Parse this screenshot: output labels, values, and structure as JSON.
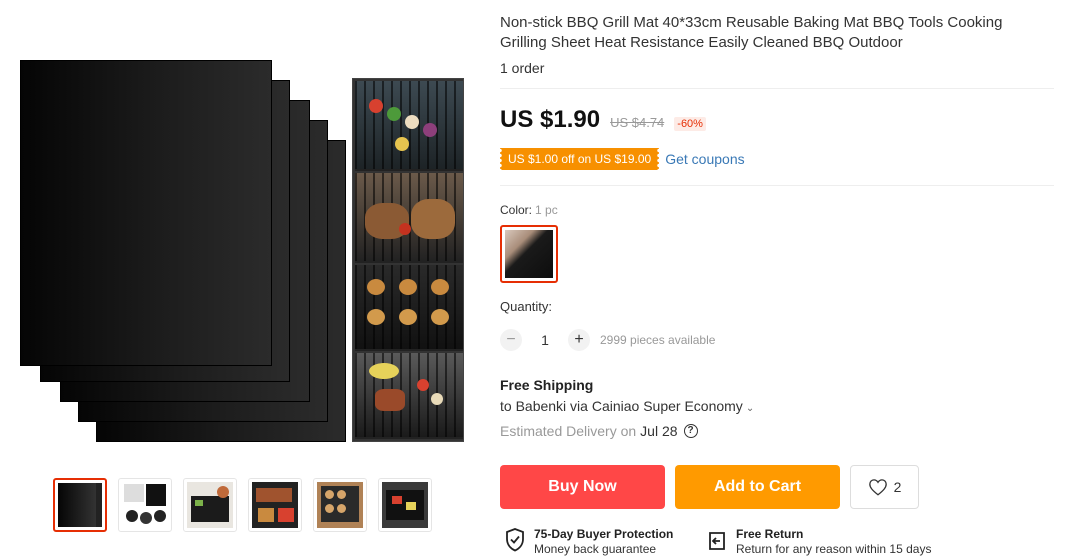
{
  "product": {
    "title": "Non-stick BBQ Grill Mat 40*33cm Reusable Baking Mat BBQ Tools Cooking Grilling Sheet Heat Resistance Easily Cleaned BBQ Outdoor",
    "orders": "1 order"
  },
  "price": {
    "current": "US $1.90",
    "original": "US $4.74",
    "discount": "-60%"
  },
  "coupon": {
    "label": "US $1.00 off on US $19.00",
    "link": "Get coupons"
  },
  "color": {
    "label": "Color:",
    "selected": "1 pc"
  },
  "quantity": {
    "label": "Quantity:",
    "value": "1",
    "minus": "−",
    "plus": "+",
    "available": "2999 pieces available"
  },
  "shipping": {
    "title": "Free Shipping",
    "to": "to Babenki via Cainiao Super Economy",
    "delivery_label": "Estimated Delivery on",
    "delivery_date": "Jul 28",
    "help": "?"
  },
  "actions": {
    "buy_now": "Buy Now",
    "add_to_cart": "Add to Cart",
    "wishlist_count": "2"
  },
  "protection": {
    "buyer_title": "75-Day Buyer Protection",
    "buyer_sub": "Money back guarantee",
    "return_title": "Free Return",
    "return_sub": "Return for any reason within 15 days"
  },
  "colors": {
    "accent_red": "#ff4747",
    "accent_orange": "#ff9a00",
    "coupon_orange": "#f79000",
    "link_blue": "#3a79b6",
    "selected_border": "#e62e04"
  },
  "icons": [
    "heart-icon",
    "shield-check-icon",
    "return-box-icon",
    "question-circle-icon",
    "chevron-down-icon"
  ]
}
